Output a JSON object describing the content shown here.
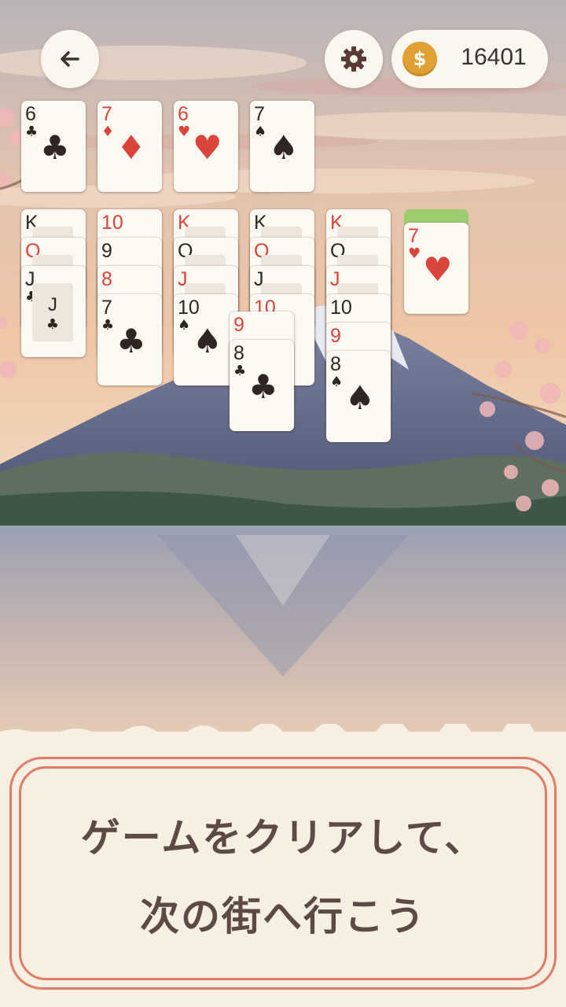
{
  "header": {
    "back_icon": "arrow-left-icon",
    "settings_icon": "gear-icon",
    "coin_icon": "coin-icon",
    "coin_symbol": "$",
    "coins": "16401"
  },
  "foundations": [
    {
      "rank": "6",
      "suit": "♣",
      "color": "black"
    },
    {
      "rank": "7",
      "suit": "♦",
      "color": "red"
    },
    {
      "rank": "6",
      "suit": "♥",
      "color": "red"
    },
    {
      "rank": "7",
      "suit": "♠",
      "color": "black"
    }
  ],
  "tableau": [
    [
      {
        "rank": "K",
        "suit": "",
        "color": "black",
        "face": true
      },
      {
        "rank": "Q",
        "suit": "",
        "color": "red",
        "face": true
      },
      {
        "rank": "J",
        "suit": "♣",
        "color": "black",
        "face": true,
        "face_letter": "J"
      }
    ],
    [
      {
        "rank": "10",
        "suit": "",
        "color": "red"
      },
      {
        "rank": "9",
        "suit": "",
        "color": "black"
      },
      {
        "rank": "8",
        "suit": "",
        "color": "red"
      },
      {
        "rank": "7",
        "suit": "♣",
        "color": "black"
      }
    ],
    [
      {
        "rank": "K",
        "suit": "",
        "color": "red",
        "face": true
      },
      {
        "rank": "Q",
        "suit": "",
        "color": "black",
        "face": true
      },
      {
        "rank": "J",
        "suit": "",
        "color": "red",
        "face": true
      },
      {
        "rank": "10",
        "suit": "♠",
        "color": "black"
      }
    ],
    [
      {
        "rank": "K",
        "suit": "",
        "color": "black",
        "face": true
      },
      {
        "rank": "Q",
        "suit": "",
        "color": "red",
        "face": true
      },
      {
        "rank": "J",
        "suit": "",
        "color": "black",
        "face": true
      },
      {
        "rank": "10",
        "suit": "",
        "color": "red"
      }
    ],
    [
      {
        "rank": "K",
        "suit": "",
        "color": "red",
        "face": true
      },
      {
        "rank": "Q",
        "suit": "",
        "color": "black",
        "face": true
      },
      {
        "rank": "J",
        "suit": "",
        "color": "red",
        "face": true
      },
      {
        "rank": "10",
        "suit": "",
        "color": "black"
      },
      {
        "rank": "9",
        "suit": "",
        "color": "red"
      },
      {
        "rank": "8",
        "suit": "♠",
        "color": "black"
      }
    ]
  ],
  "dragging": [
    {
      "rank": "9",
      "suit": "",
      "color": "red"
    },
    {
      "rank": "8",
      "suit": "♣",
      "color": "black"
    }
  ],
  "waste": {
    "rank": "7",
    "suit": "♥",
    "color": "red"
  },
  "banner": {
    "line1": "ゲームをクリアして、",
    "line2": "次の街へ行こう"
  },
  "colors": {
    "red_suit": "#d9443b",
    "black_suit": "#2f2623",
    "coin": "#e0a033",
    "frame": "#e07c69",
    "stock_strip": "#9ccc6f"
  }
}
